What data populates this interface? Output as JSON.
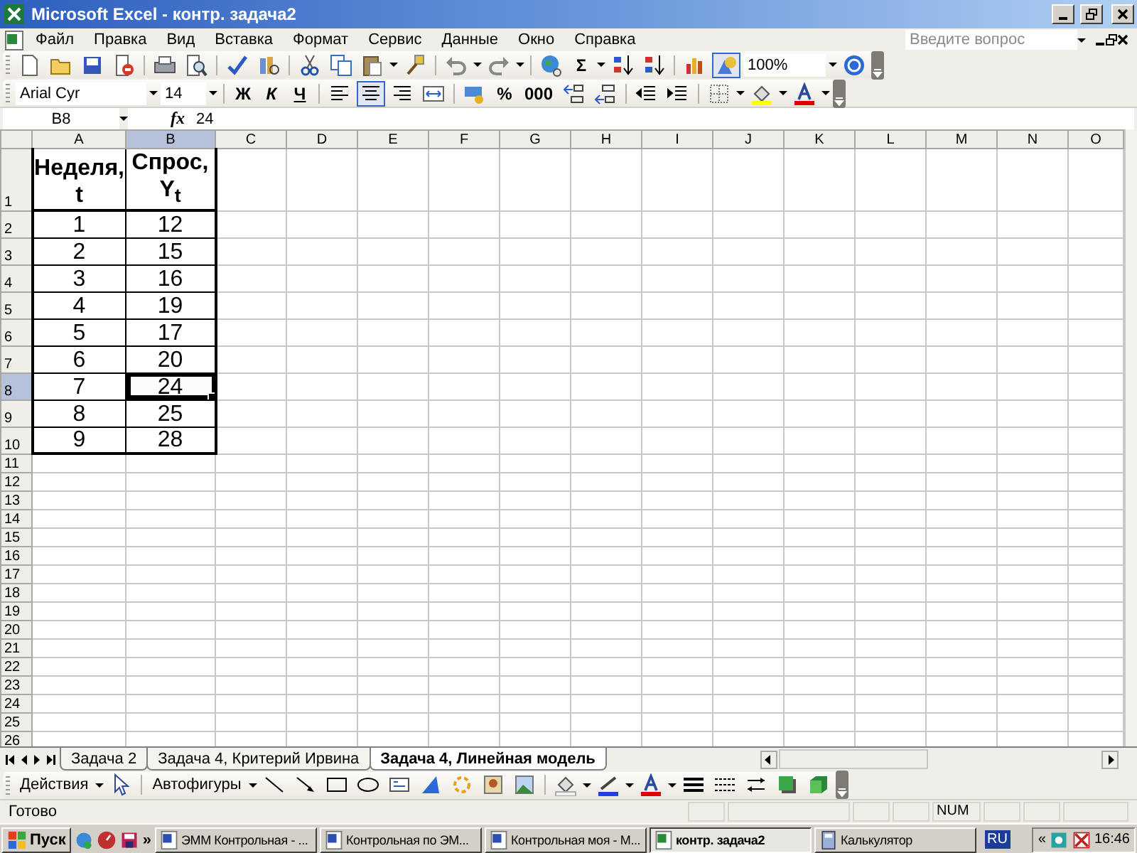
{
  "window": {
    "title": "Microsoft Excel - контр. задача2"
  },
  "menu": [
    "Файл",
    "Правка",
    "Вид",
    "Вставка",
    "Формат",
    "Сервис",
    "Данные",
    "Окно",
    "Справка"
  ],
  "help_search": {
    "placeholder": "Введите вопрос"
  },
  "standard_toolbar": {
    "sum": "Σ",
    "drawing_on": true,
    "zoom": "100%"
  },
  "formatting_toolbar": {
    "font": "Arial Cyr",
    "size": "14",
    "style_buttons": [
      {
        "label": "Ж",
        "on": false
      },
      {
        "label": "К",
        "on": false
      },
      {
        "label": "Ч",
        "on": false
      }
    ],
    "align_buttons": [
      {
        "selected": false
      },
      {
        "selected": true
      },
      {
        "selected": false
      }
    ],
    "percent": "%",
    "thousands": "000"
  },
  "formula_bar": {
    "name_box": "B8",
    "fx": "fx",
    "value": "24"
  },
  "columns": [
    {
      "label": "A",
      "selected": false
    },
    {
      "label": "B",
      "selected": true
    },
    {
      "label": "C",
      "selected": false
    },
    {
      "label": "D",
      "selected": false
    },
    {
      "label": "E",
      "selected": false
    },
    {
      "label": "F",
      "selected": false
    },
    {
      "label": "G",
      "selected": false
    },
    {
      "label": "H",
      "selected": false
    },
    {
      "label": "I",
      "selected": false
    },
    {
      "label": "J",
      "selected": false
    },
    {
      "label": "K",
      "selected": false
    },
    {
      "label": "L",
      "selected": false
    },
    {
      "label": "M",
      "selected": false
    },
    {
      "label": "N",
      "selected": false
    },
    {
      "label": "O",
      "selected": false
    }
  ],
  "rows": [
    {
      "label": "1",
      "selected": false,
      "cells": [
        {
          "text": "Неделя, t",
          "selected": false
        },
        {
          "text": "Спрос, Y$_{t}$",
          "selected": false
        }
      ]
    },
    {
      "label": "2",
      "selected": false,
      "cells": [
        {
          "text": "1",
          "selected": false
        },
        {
          "text": "12",
          "selected": false
        }
      ]
    },
    {
      "label": "3",
      "selected": false,
      "cells": [
        {
          "text": "2",
          "selected": false
        },
        {
          "text": "15",
          "selected": false
        }
      ]
    },
    {
      "label": "4",
      "selected": false,
      "cells": [
        {
          "text": "3",
          "selected": false
        },
        {
          "text": "16",
          "selected": false
        }
      ]
    },
    {
      "label": "5",
      "selected": false,
      "cells": [
        {
          "text": "4",
          "selected": false
        },
        {
          "text": "19",
          "selected": false
        }
      ]
    },
    {
      "label": "6",
      "selected": false,
      "cells": [
        {
          "text": "5",
          "selected": false
        },
        {
          "text": "17",
          "selected": false
        }
      ]
    },
    {
      "label": "7",
      "selected": false,
      "cells": [
        {
          "text": "6",
          "selected": false
        },
        {
          "text": "20",
          "selected": false
        }
      ]
    },
    {
      "label": "8",
      "selected": true,
      "cells": [
        {
          "text": "7",
          "selected": false
        },
        {
          "text": "24",
          "selected": true
        }
      ]
    },
    {
      "label": "9",
      "selected": false,
      "cells": [
        {
          "text": "8",
          "selected": false
        },
        {
          "text": "25",
          "selected": false
        }
      ]
    },
    {
      "label": "10",
      "selected": false,
      "cells": [
        {
          "text": "9",
          "selected": false
        },
        {
          "text": "28",
          "selected": false
        }
      ]
    },
    {
      "label": "11",
      "selected": false
    },
    {
      "label": "12",
      "selected": false
    },
    {
      "label": "13",
      "selected": false
    },
    {
      "label": "14",
      "selected": false
    },
    {
      "label": "15",
      "selected": false
    },
    {
      "label": "16",
      "selected": false
    },
    {
      "label": "17",
      "selected": false
    },
    {
      "label": "18",
      "selected": false
    },
    {
      "label": "19",
      "selected": false
    },
    {
      "label": "20",
      "selected": false
    },
    {
      "label": "21",
      "selected": false
    },
    {
      "label": "22",
      "selected": false
    },
    {
      "label": "23",
      "selected": false
    },
    {
      "label": "24",
      "selected": false
    },
    {
      "label": "25",
      "selected": false
    },
    {
      "label": "26",
      "selected": false
    }
  ],
  "sheet_tabs": [
    {
      "label": "Задача 2",
      "selected": false
    },
    {
      "label": "Задача 4, Критерий Ирвина",
      "selected": false
    },
    {
      "label": "Задача 4, Линейная модель",
      "selected": true
    }
  ],
  "drawing_toolbar": {
    "actions": "Действия",
    "autoshapes": "Автофигуры"
  },
  "status_bar": {
    "text": "Готово",
    "indicators": [
      "NUM"
    ]
  },
  "taskbar": {
    "start": "Пуск",
    "quick_launch_more": "»",
    "tasks": [
      {
        "label": "ЭММ Контрольная - ...",
        "selected": false
      },
      {
        "label": "Контрольная по ЭМ...",
        "selected": false
      },
      {
        "label": "Контрольная моя - М...",
        "selected": false
      },
      {
        "label": "контр. задача2",
        "selected": true
      },
      {
        "label": "Калькулятор",
        "selected": false
      }
    ],
    "language": "RU",
    "chevron": "«",
    "clock": "16:46"
  }
}
